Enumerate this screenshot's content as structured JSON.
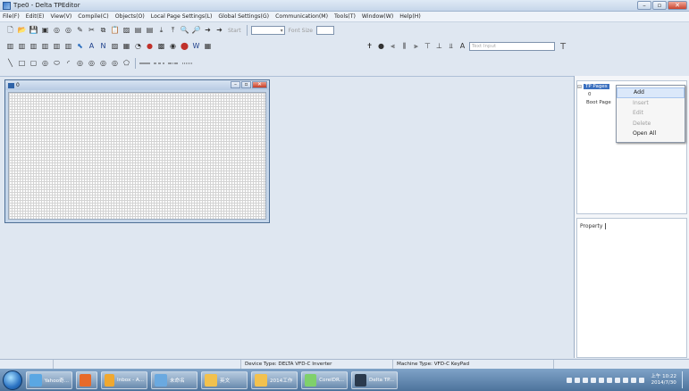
{
  "window": {
    "title": "Tpe0 - Delta TPEditor",
    "icon": "app-icon",
    "controls": [
      "–",
      "▫",
      "✕"
    ]
  },
  "menubar": {
    "items": [
      "File(F)",
      "Edit(E)",
      "View(V)",
      "Compile(C)",
      "Objects(O)",
      "Local Page Settings(L)",
      "Global Settings(G)",
      "Communication(M)",
      "Tools(T)",
      "Window(W)",
      "Help(H)"
    ]
  },
  "toolbar1": {
    "icons": [
      "new-icon",
      "open-icon",
      "save-icon",
      "save-all-icon",
      "circle-icon",
      "circle-icon",
      "brush-icon",
      "cut-icon",
      "copy-icon",
      "paste-icon",
      "image-icon",
      "page-icon",
      "page-icon",
      "download-icon",
      "upload-icon",
      "zoom-in-icon",
      "zoom-out-icon",
      "arrow-icon",
      "arrow-icon"
    ],
    "start_label": "Start",
    "zoom_combo": "",
    "font_size_label": "Font Size",
    "font_size_value": ""
  },
  "toolbar2": {
    "icons": [
      "align-icon",
      "align-icon",
      "align-icon",
      "align-icon",
      "align-icon",
      "align-icon",
      "select-icon",
      "text-icon",
      "number-icon",
      "image-icon",
      "bitmap-icon",
      "meter-icon",
      "lamp-icon",
      "chart-icon",
      "dial-icon",
      "record-icon",
      "word-icon",
      "table-icon"
    ],
    "icons_b": [
      "pin-icon",
      "dot-icon",
      "align-left-icon",
      "align-center-icon",
      "align-right-icon",
      "align-top-icon",
      "align-middle-icon",
      "align-bottom-icon",
      "font-icon"
    ],
    "text_input_placeholder": "Text Input",
    "font_glyph": "T"
  },
  "toolbar3": {
    "icons": [
      "line-icon",
      "rect-icon",
      "round-rect-icon",
      "circle-icon",
      "ellipse-icon",
      "arc-icon",
      "circle-icon",
      "circle-icon",
      "circle-icon",
      "circle-icon",
      "polygon-icon"
    ],
    "line_styles": [
      "solid-line",
      "dashed-line",
      "dashdot-line",
      "dotted-line"
    ]
  },
  "screen_window": {
    "title": "0",
    "controls": [
      "–",
      "▫",
      "✕"
    ]
  },
  "tree": {
    "root": "TP Pages",
    "child": "0",
    "boot": "Boot Page"
  },
  "context_menu": {
    "items": [
      {
        "label": "Add",
        "enabled": true,
        "highlighted": true
      },
      {
        "label": "Insert",
        "enabled": false,
        "highlighted": false
      },
      {
        "label": "Edit",
        "enabled": false,
        "highlighted": false
      },
      {
        "label": "Delete",
        "enabled": false,
        "highlighted": false
      },
      {
        "label": "Open All",
        "enabled": true,
        "highlighted": false
      }
    ]
  },
  "property_panel": {
    "tab": "Property"
  },
  "statusbar": {
    "device_type": "Device Type: DELTA VFD-C Inverter",
    "machine_type": "Machine Type: VFD-C KeyPad"
  },
  "taskbar": {
    "items": [
      {
        "label": "Yahoo奇...",
        "icon": "ie-icon",
        "color": "#5aa7e3",
        "wide": true
      },
      {
        "label": "",
        "icon": "media-icon",
        "color": "#e76a2a",
        "wide": false
      },
      {
        "label": "Inbox - A...",
        "icon": "outlook-icon",
        "color": "#f0a830",
        "wide": true
      },
      {
        "label": "未命名",
        "icon": "paint-icon",
        "color": "#6aa9e0",
        "wide": true
      },
      {
        "label": "英文",
        "icon": "folder-icon",
        "color": "#f2c14e",
        "wide": true
      },
      {
        "label": "2014工作",
        "icon": "folder-icon",
        "color": "#f2c14e",
        "wide": true
      },
      {
        "label": "CorelDR...",
        "icon": "corel-icon",
        "color": "#7fd06b",
        "wide": true
      },
      {
        "label": "Delta TP...",
        "icon": "delta-tp-icon",
        "color": "#2b3a4d",
        "wide": true
      }
    ],
    "clock_time": "上午 10:22",
    "clock_date": "2014/7/30"
  }
}
